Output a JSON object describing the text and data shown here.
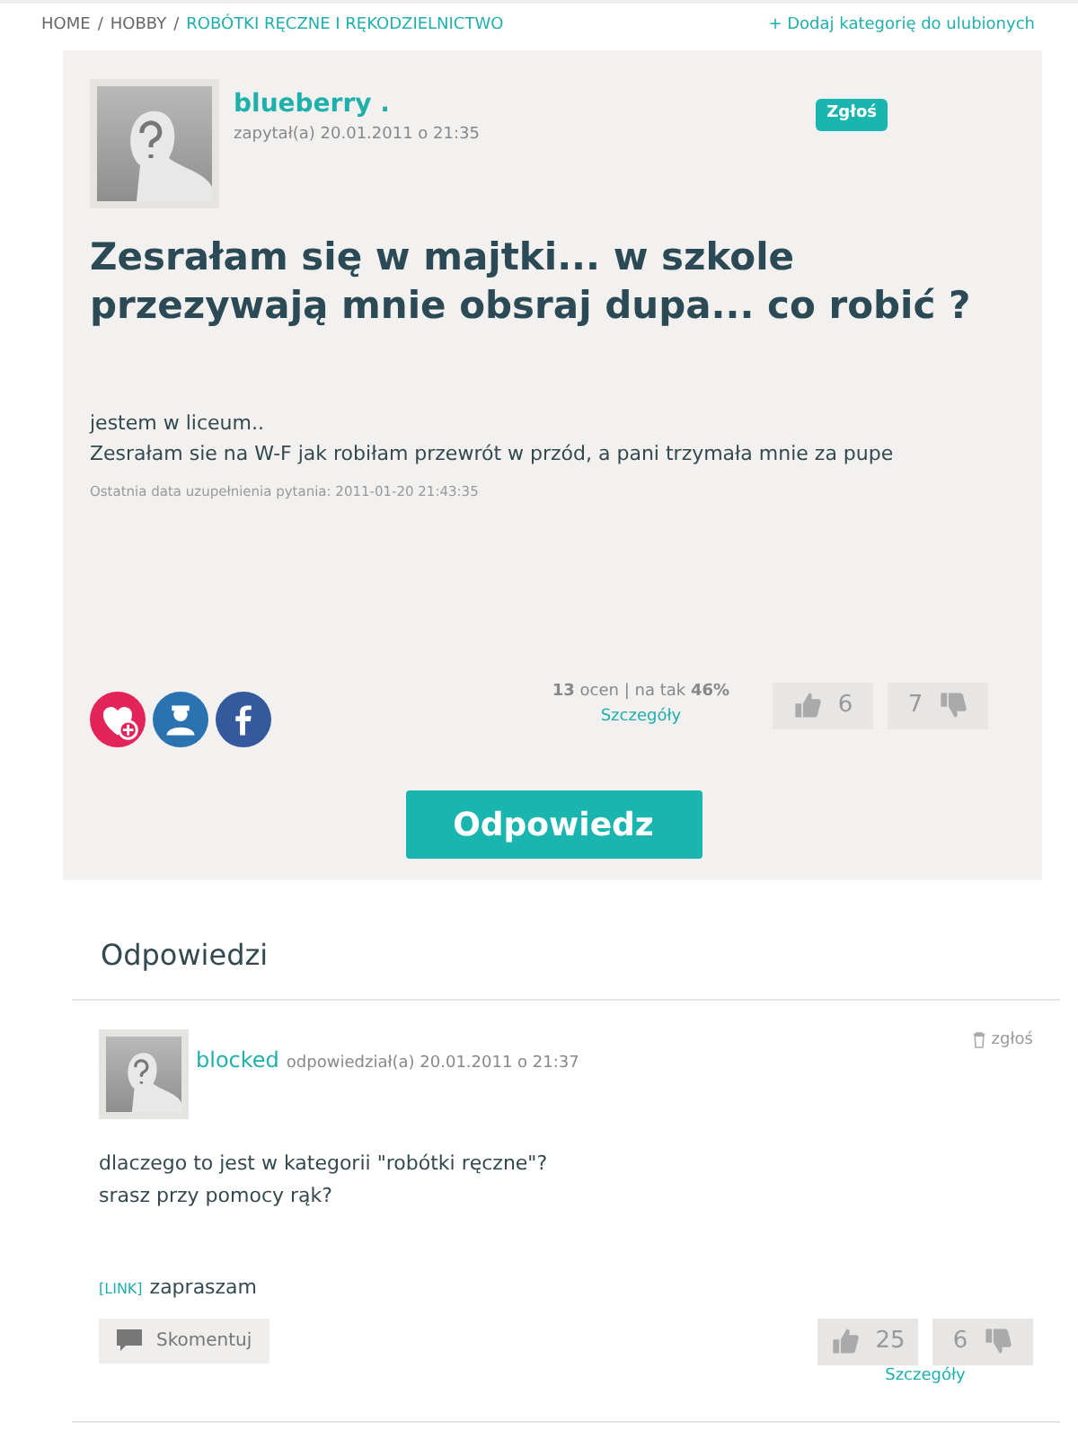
{
  "breadcrumb": [
    {
      "label": "HOME",
      "current": false
    },
    {
      "label": "HOBBY",
      "current": false
    },
    {
      "label": "ROBÓTKI RĘCZNE I RĘKODZIELNICTWO",
      "current": true
    }
  ],
  "breadcrumb_separator": "/",
  "favorite_link": "+ Dodaj kategorię do ulubionych",
  "question": {
    "author": "blueberry .",
    "meta": "zapytał(a) 20.01.2011 o 21:35",
    "report": "Zgłoś",
    "title": "Zesrałam się w majtki... w szkole przezywają mnie obsraj dupa... co robić ?",
    "body": [
      "jestem w liceum..",
      "Zesrałam sie na W-F jak robiłam przewrót w przód, a pani trzymała mnie za pupe"
    ],
    "updated": "Ostatnia data uzupełnienia pytania: 2011-01-20 21:43:35",
    "ratings": "**13** ocen | na tak **46%**",
    "details": "Szczegóły",
    "up": "6",
    "down": "7"
  },
  "answer_button": "Odpowiedz",
  "answers_heading": "Odpowiedzi",
  "answers": [
    {
      "author": "blocked",
      "meta": "odpowiedział(a) 20.01.2011 o 21:37",
      "report": "zgłoś",
      "body": [
        "dlaczego to jest w kategorii \"robótki ręczne\"?",
        "srasz przy pomocy rąk?"
      ],
      "link_tag": "[LINK]",
      "link_text": "zapraszam",
      "comment": "Skomentuj",
      "up": "25",
      "down": "6",
      "details": "Szczegóły"
    }
  ]
}
